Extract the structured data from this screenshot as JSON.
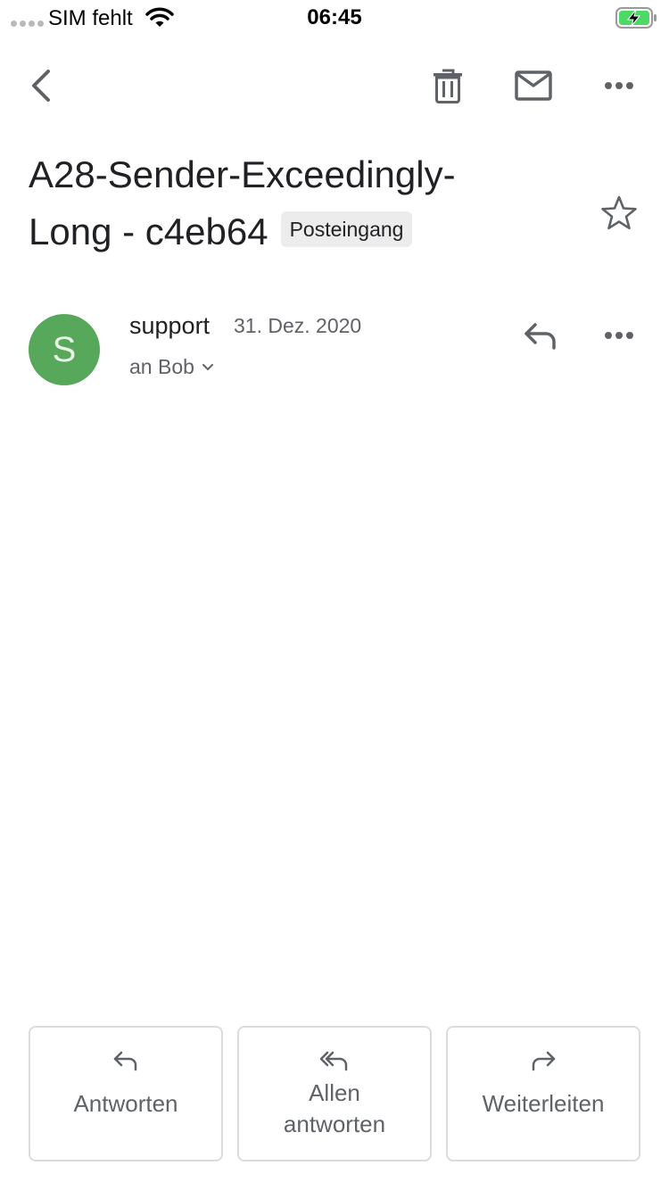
{
  "status_bar": {
    "carrier": "SIM fehlt",
    "time": "06:45",
    "icons": [
      "signal-dots-icon",
      "wifi-icon",
      "battery-charging-icon"
    ]
  },
  "toolbar": {
    "icons": [
      "back-arrow-icon",
      "trash-icon",
      "mail-icon",
      "more-horizontal-icon"
    ]
  },
  "email": {
    "subject": "A28-Sender-Exceedingly-Long - c4eb64",
    "label": "Posteingang",
    "starred": false
  },
  "message": {
    "avatar_letter": "S",
    "avatar_color": "#57a85b",
    "sender": "support",
    "date": "31. Dez. 2020",
    "recipient": "an Bob"
  },
  "actions": {
    "reply_label": "Antworten",
    "reply_all_label_line1": "Allen",
    "reply_all_label_line2": "antworten",
    "forward_label": "Weiterleiten"
  }
}
